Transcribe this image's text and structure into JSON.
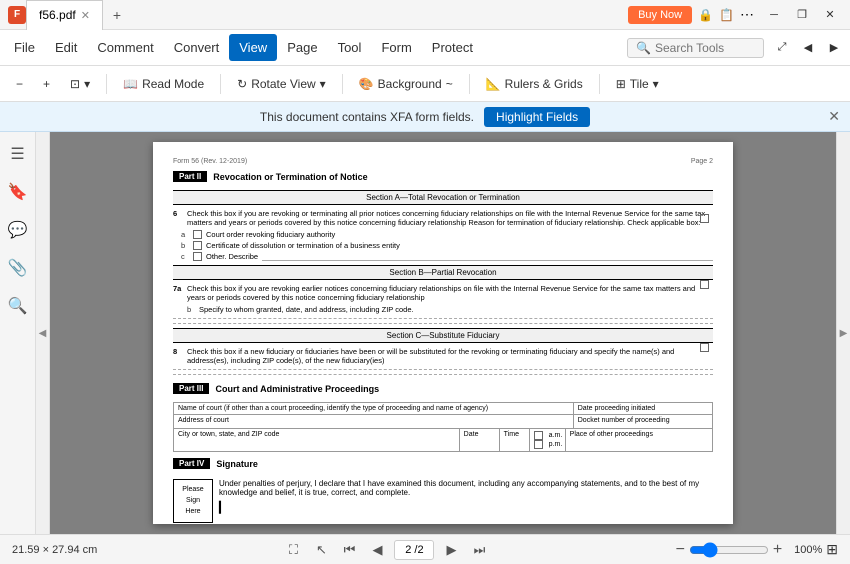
{
  "titleBar": {
    "appIcon": "F",
    "fileName": "f56.pdf",
    "tabClose": "✕",
    "newTab": "+",
    "winButtons": {
      "minimize": "─",
      "maximize": "□",
      "restore": "❐",
      "close": "✕",
      "more": "⋯"
    }
  },
  "menuBar": {
    "items": [
      "File",
      "Edit",
      "Comment",
      "Convert",
      "View",
      "Page",
      "Tool",
      "Form",
      "Protect"
    ]
  },
  "toolbar": {
    "zoomOut": "−",
    "zoomIn": "+",
    "zoomDropdown": "▾",
    "adjustPages": "▾",
    "readMode": "Read Mode",
    "rotateView": "Rotate View",
    "rotateDropdown": "▾",
    "background": "Background",
    "backgroundDropdown": "~",
    "rulersGrids": "Rulers & Grids",
    "tile": "Tile",
    "tileDropdown": "▾",
    "searchIcon": "🔍",
    "searchPlaceholder": "Search Tools"
  },
  "notification": {
    "message": "This document contains XFA form fields.",
    "buttonLabel": "Highlight Fields",
    "closeIcon": "✕"
  },
  "sidebar": {
    "icons": [
      "☰",
      "🔖",
      "💬",
      "📎",
      "🔍"
    ]
  },
  "pdfContent": {
    "formHeader": "Form 56 (Rev. 12-2019)",
    "pageNumber": "Page 2",
    "part2": {
      "badge": "Part II",
      "title": "Revocation or Termination of Notice"
    },
    "sectionA": {
      "title": "Section A—Total Revocation or Termination",
      "row6": {
        "num": "6",
        "text": "Check this box if you are revoking or terminating all prior notices concerning fiduciary relationships on file with the Internal Revenue Service for the same tax matters and years or periods covered by this notice concerning fiduciary relationship Reason for termination of fiduciary relationship. Check applicable box:"
      },
      "checkboxes": [
        {
          "label": "a",
          "text": "Court order revoking fiduciary authority"
        },
        {
          "label": "b",
          "text": "Certificate of dissolution or termination of a business entity"
        },
        {
          "label": "c",
          "text": "Other. Describe"
        }
      ]
    },
    "sectionB": {
      "title": "Section B—Partial Revocation",
      "row7a": {
        "num": "7a",
        "text": "Check this box if you are revoking earlier notices concerning fiduciary relationships on file with the Internal Revenue Service for the same tax matters and years or periods covered by this notice concerning fiduciary relationship"
      },
      "row7b": {
        "label": "b",
        "text": "Specify to whom granted, date, and address, including ZIP code."
      }
    },
    "sectionC": {
      "title": "Section C—Substitute Fiduciary",
      "row8": {
        "num": "8",
        "text": "Check this box if a new fiduciary or fiduciaries have been or will be substituted for the revoking or terminating fiduciary and specify the name(s) and address(es), including ZIP code(s), of the new fiduciary(ies)"
      }
    },
    "part3": {
      "badge": "Part III",
      "title": "Court and Administrative Proceedings"
    },
    "tableHeaders": [
      {
        "text": "Name of court (if other than a court proceeding, identify the type of proceeding and name of agency)",
        "flex": 3
      },
      {
        "text": "Date proceeding initiated",
        "flex": 1
      }
    ],
    "tableRow2Headers": [
      {
        "text": "Address of court",
        "flex": 3
      },
      {
        "text": "Docket number of proceeding",
        "flex": 1
      }
    ],
    "tableRow3": {
      "city": "City or town, state, and ZIP code",
      "date": "Date",
      "time": "Time",
      "amLabel": "a.m.",
      "pmLabel": "p.m.",
      "place": "Place of other proceedings"
    },
    "part4": {
      "badge": "Part IV",
      "title": "Signature"
    },
    "signatureText": "Under penalties of perjury, I declare that I have examined this document, including any accompanying statements, and to the best of my knowledge and belief, it is true, correct, and complete.",
    "pleaseSignLabel": "Please\nSign\nHere"
  },
  "statusBar": {
    "dimensions": "21.59 × 27.94 cm",
    "navFirst": "⏮",
    "navPrev": "◀",
    "pageDisplay": "2 / 2",
    "navNext": "▶",
    "navLast": "⏭",
    "zoomOut": "−",
    "zoomIn": "+",
    "zoomLevel": "100%",
    "fitIcon": "⊞"
  },
  "buyNow": {
    "label": "Buy Now",
    "icons": [
      "🔒",
      "📋"
    ]
  },
  "colors": {
    "accent": "#0068c0",
    "partBadgeBg": "#000000",
    "notifBg": "#e8f4fd",
    "highlightBtn": "#0068c0"
  }
}
